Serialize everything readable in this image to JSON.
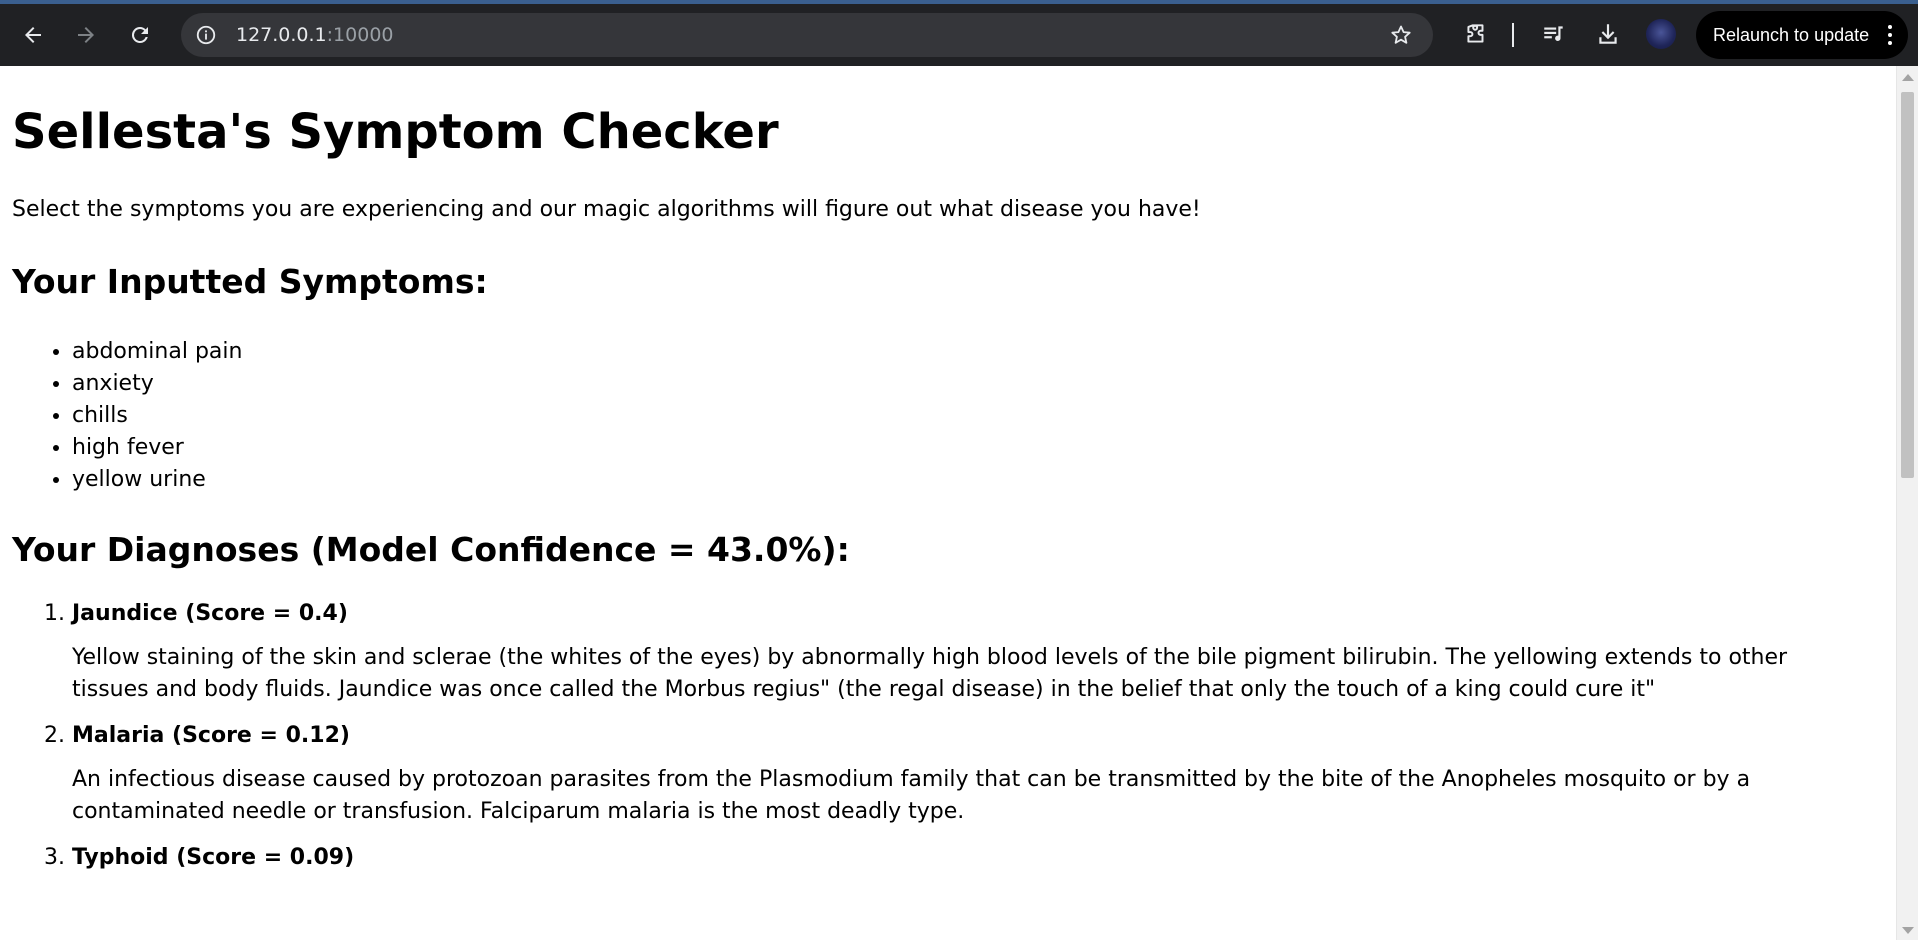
{
  "browser": {
    "url_host": "127.0.0.1",
    "url_port": ":10000",
    "relaunch_label": "Relaunch to update",
    "icons": [
      "back-icon",
      "forward-icon",
      "reload-icon",
      "site-info-icon",
      "bookmark-star-icon",
      "extensions-icon",
      "media-icon",
      "download-icon",
      "profile-avatar",
      "menu-kebab-icon"
    ]
  },
  "page": {
    "title": "Sellesta's Symptom Checker",
    "intro": "Select the symptoms you are experiencing and our magic algorithms will figure out what disease you have!",
    "symptoms_heading": "Your Inputted Symptoms:",
    "symptoms": [
      "abdominal pain",
      "anxiety",
      "chills",
      "high fever",
      "yellow urine"
    ],
    "diagnoses_heading": "Your Diagnoses (Model Confidence = 43.0%):",
    "diagnoses": [
      {
        "title": "Jaundice (Score = 0.4)",
        "description": "Yellow staining of the skin and sclerae (the whites of the eyes) by abnormally high blood levels of the bile pigment bilirubin. The yellowing extends to other tissues and body fluids. Jaundice was once called the Morbus regius\" (the regal disease) in the belief that only the touch of a king could cure it\""
      },
      {
        "title": "Malaria (Score = 0.12)",
        "description": "An infectious disease caused by protozoan parasites from the Plasmodium family that can be transmitted by the bite of the Anopheles mosquito or by a contaminated needle or transfusion. Falciparum malaria is the most deadly type."
      },
      {
        "title": "Typhoid (Score = 0.09)",
        "description": ""
      }
    ]
  },
  "colors": {
    "chrome_bg": "#202124",
    "omnibox_bg": "#35363a",
    "relaunch_bg": "#000000",
    "page_bg": "#ffffff",
    "text": "#000000"
  }
}
